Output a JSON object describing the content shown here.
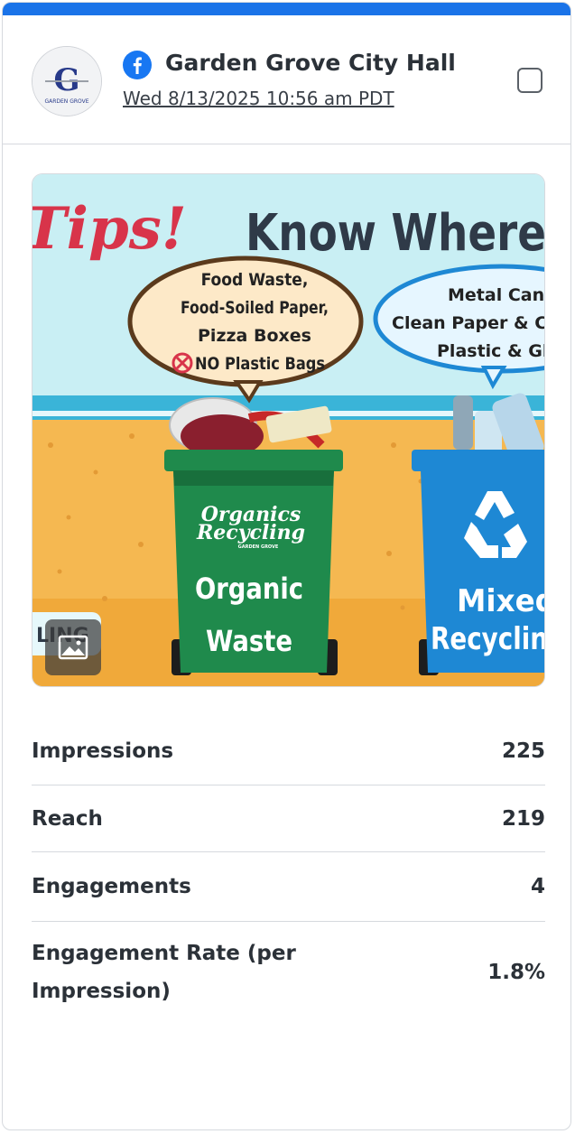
{
  "post": {
    "account_name": "Garden Grove City Hall",
    "date": "Wed 8/13/2025 10:56 am PDT",
    "avatar_logo_text": "G",
    "avatar_logo_subtext": "GARDEN GROVE"
  },
  "media": {
    "headline_left": "Tips!",
    "headline_right": "Know Where",
    "bubble_left": [
      "Food Waste,",
      "Food-Soiled Paper,",
      "Pizza Boxes",
      "NO Plastic Bags"
    ],
    "bubble_right": [
      "Metal Cans,",
      "Clean Paper & Card",
      "Plastic & Glas"
    ],
    "bin_left_logo": [
      "Organics",
      "Recycling"
    ],
    "bin_left_logo_small": "GARDEN GROVE",
    "bin_left_label": [
      "Organic",
      "Waste"
    ],
    "bin_right_label": [
      "Mixed",
      "Recyclin"
    ],
    "edge_text": "LING"
  },
  "metrics": [
    {
      "label": "Impressions",
      "value": "225"
    },
    {
      "label": "Reach",
      "value": "219"
    },
    {
      "label": "Engagements",
      "value": "4"
    },
    {
      "label": "Engagement Rate (per Impression)",
      "value": "1.8%"
    }
  ],
  "colors": {
    "accent": "#1a73e8",
    "facebook": "#1877f2",
    "green_bin": "#1f8a4c",
    "blue_bin": "#1e88d4"
  }
}
